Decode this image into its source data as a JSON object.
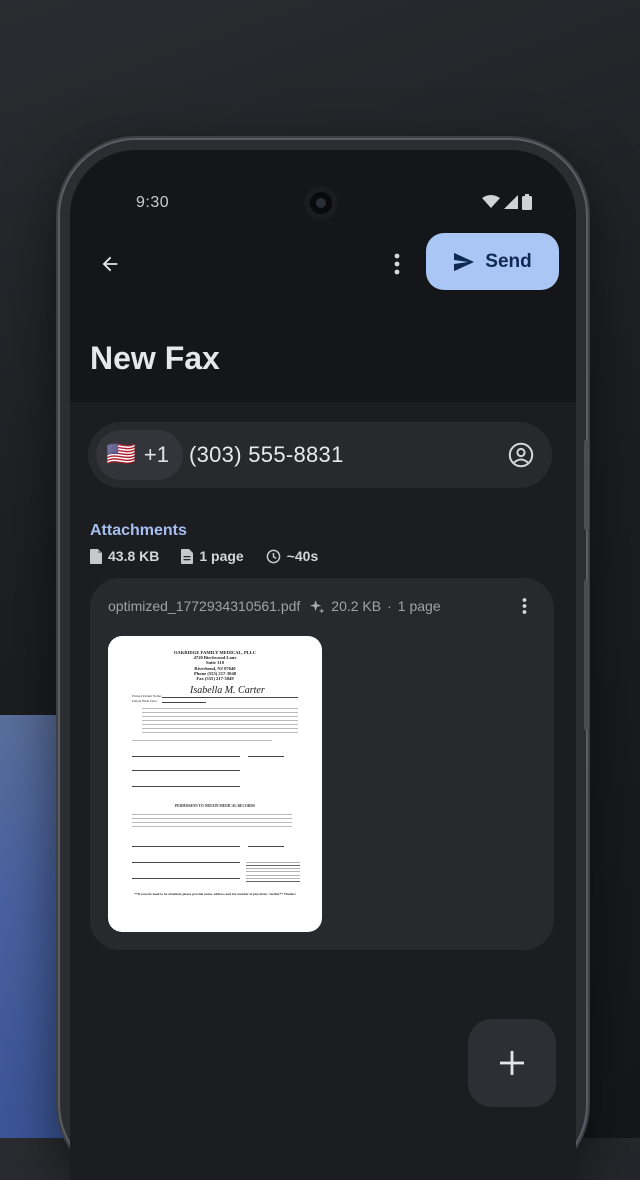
{
  "status_bar": {
    "time": "9:30"
  },
  "header": {
    "send_label": "Send",
    "title": "New Fax"
  },
  "recipient": {
    "flag": "🇺🇸",
    "country_code": "+1",
    "number": "(303) 555-8831"
  },
  "attachments": {
    "heading": "Attachments",
    "total_size": "43.8 KB",
    "page_count": "1 page",
    "time_estimate": "~40s"
  },
  "file": {
    "name": "optimized_1772934310561.pdf",
    "optimized_size": "20.2 KB",
    "separator": "·",
    "pages": "1 page"
  },
  "document_preview": {
    "letterhead": [
      "OAKRIDGE FAMILY MEDICAL, PLLC",
      "4720 Birchwood Lane",
      "Suite 310",
      "Riverbend, NJ 07640",
      "Phone (555) 217-3048",
      "Fax (555) 217-3049"
    ],
    "signature": "Isabella M. Carter",
    "printed_patient_name": "Printed Patient Name:",
    "patient_birth_date": "Patient Birth Date:",
    "section_title": "PERMISSION TO OBTAIN MEDICAL RECORDS",
    "footer": "**If records need to be obtained, please provide name, address and fax number of physician / facility** Thanks!"
  },
  "colors": {
    "accent": "#a9c6f4",
    "heading": "#a6bff0",
    "surface": "#27292d"
  }
}
